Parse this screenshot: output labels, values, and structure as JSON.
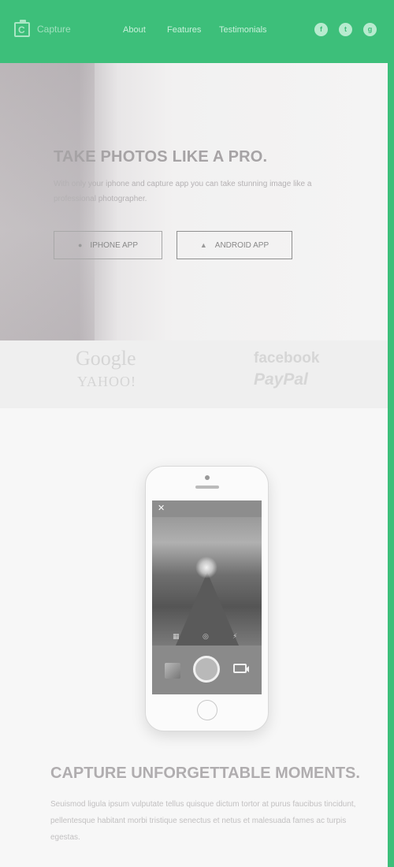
{
  "header": {
    "brand": "Capture",
    "nav": [
      "About",
      "Features",
      "Testimonials"
    ],
    "social_icons": [
      "facebook-icon",
      "twitter-icon",
      "google-plus-icon"
    ],
    "accent_color": "#3dbf7a"
  },
  "hero": {
    "title": "TAKE PHOTOS LIKE A PRO.",
    "subtitle": "With only your iphone and capture app you can take stunning image like a professional photographer.",
    "buttons": {
      "iphone": "IPHONE APP",
      "android": "ANDROID APP"
    }
  },
  "partners": {
    "google": "Google",
    "yahoo": "YAHOO!",
    "facebook": "facebook",
    "paypal": "PayPal"
  },
  "phone": {
    "close_icon": "close-icon",
    "shutter": "shutter-button",
    "video_icon": "video-camera-icon"
  },
  "moments": {
    "title": "CAPTURE UNFORGETTABLE MOMENTS.",
    "text": "Seuismod ligula ipsum vulputate tellus quisque dictum tortor at purus faucibus tincidunt, pellentesque habitant morbi tristique senectus et netus et malesuada fames ac turpis egestas."
  }
}
